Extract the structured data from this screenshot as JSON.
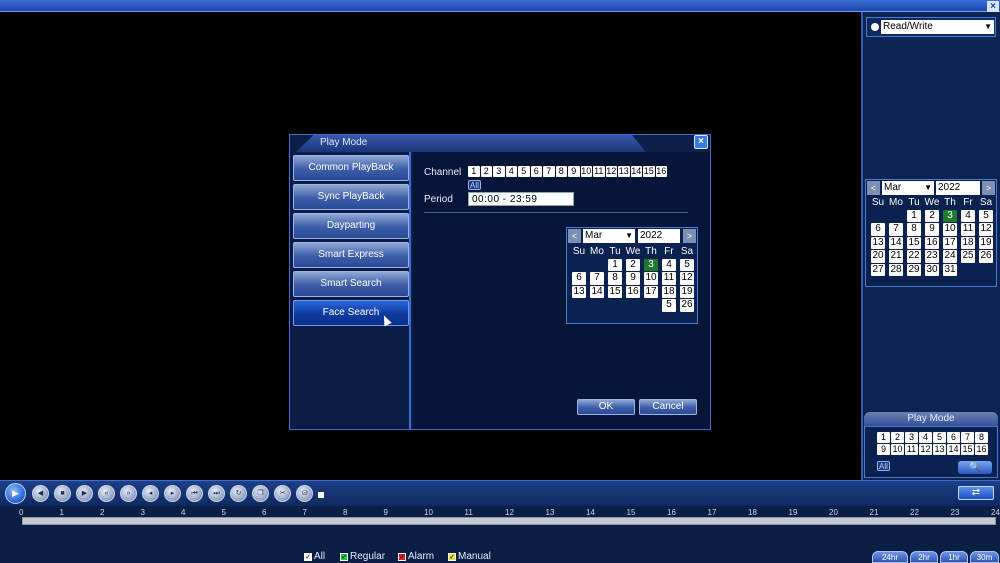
{
  "side": {
    "mode_select": "Read/Write",
    "calendar": {
      "month": "Mar",
      "year": "2022",
      "prev": "<",
      "next": ">",
      "weekdays": [
        "Su",
        "Mo",
        "Tu",
        "We",
        "Th",
        "Fr",
        "Sa"
      ],
      "days": [
        "",
        "",
        "1",
        "2",
        "3",
        "4",
        "5",
        "6",
        "7",
        "8",
        "9",
        "10",
        "11",
        "12",
        "13",
        "14",
        "15",
        "16",
        "17",
        "18",
        "19",
        "20",
        "21",
        "22",
        "23",
        "24",
        "25",
        "26",
        "27",
        "28",
        "29",
        "30",
        "31"
      ],
      "highlight_day": "3"
    },
    "play_mode_title": "Play Mode",
    "channels": [
      "1",
      "2",
      "3",
      "4",
      "5",
      "6",
      "7",
      "8",
      "9",
      "10",
      "11",
      "12",
      "13",
      "14",
      "15",
      "16"
    ],
    "all_label": "All",
    "search_icon": "magnifier-icon"
  },
  "dialog": {
    "title": "Play Mode",
    "close_label": "×",
    "modes": [
      "Common PlayBack",
      "Sync PlayBack",
      "Dayparting",
      "Smart Express",
      "Smart Search",
      "Face Search"
    ],
    "active_mode": "Face Search",
    "channel_label": "Channel",
    "channels": [
      "1",
      "2",
      "3",
      "4",
      "5",
      "6",
      "7",
      "8",
      "9",
      "10",
      "11",
      "12",
      "13",
      "14",
      "15",
      "16"
    ],
    "all_label": "All",
    "period_label": "Period",
    "period_value": "00:00  -  23:59",
    "calendar": {
      "month": "Mar",
      "year": "2022",
      "prev": "<",
      "next": ">",
      "weekdays": [
        "Su",
        "Mo",
        "Tu",
        "We",
        "Th",
        "Fr",
        "Sa"
      ],
      "rows": [
        [
          "",
          "",
          "1",
          "2",
          "3",
          "4",
          "5"
        ],
        [
          "6",
          "7",
          "8",
          "9",
          "10",
          "11",
          "12"
        ],
        [
          "13",
          "14",
          "15",
          "16",
          "17",
          "18",
          "19"
        ],
        [
          "",
          "",
          "",
          "",
          "",
          "5",
          "26"
        ]
      ],
      "highlight_day": "3"
    },
    "ok_label": "OK",
    "cancel_label": "Cancel"
  },
  "controls": {
    "icons": [
      "play-icon",
      "previous-frame-icon",
      "stop-icon",
      "reverse-play-icon",
      "rewind-icon",
      "fast-forward-icon",
      "step-back-icon",
      "step-forward-icon",
      "skip-back-icon",
      "skip-forward-icon",
      "loop-icon",
      "multi-window-icon",
      "clip-icon",
      "backup-icon"
    ]
  },
  "timeline": {
    "hours": [
      "0",
      "1",
      "2",
      "3",
      "4",
      "5",
      "6",
      "7",
      "8",
      "9",
      "10",
      "11",
      "12",
      "13",
      "14",
      "15",
      "16",
      "17",
      "18",
      "19",
      "20",
      "21",
      "22",
      "23",
      "24"
    ],
    "legend": [
      {
        "label": "All",
        "color": "#ffffff"
      },
      {
        "label": "Regular",
        "color": "#22c23a"
      },
      {
        "label": "Alarm",
        "color": "#e02020"
      },
      {
        "label": "Manual",
        "color": "#e8e23a"
      }
    ],
    "zoom": [
      "24hr",
      "2hr",
      "1hr",
      "30m"
    ]
  }
}
